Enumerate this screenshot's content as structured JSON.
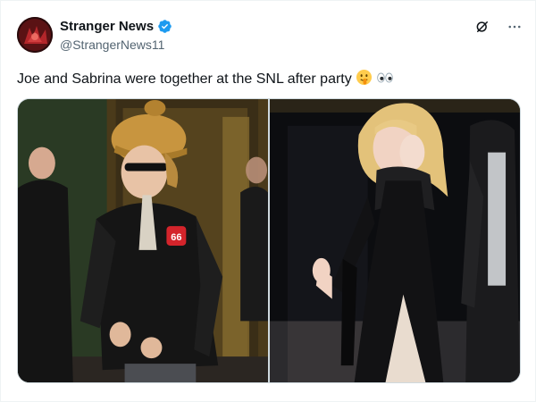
{
  "post": {
    "author": {
      "display_name": "Stranger News",
      "handle": "@StrangerNews11",
      "verified": true,
      "avatar": "stranger-things-avatar"
    },
    "text": "Joe and Sabrina were together at the SNL after party",
    "emojis": [
      "shushing-face-emoji",
      "eyes-emoji"
    ],
    "actions": {
      "grok_icon": "grok-icon",
      "more_icon": "more-options-icon"
    },
    "media": [
      {
        "kind": "photo",
        "subject": "joe-photo",
        "badge_text": "66"
      },
      {
        "kind": "photo",
        "subject": "sabrina-photo"
      }
    ]
  },
  "colors": {
    "verified_blue": "#1d9bf0",
    "text_primary": "#0f1419",
    "text_secondary": "#536471",
    "border": "#cfd9de"
  }
}
